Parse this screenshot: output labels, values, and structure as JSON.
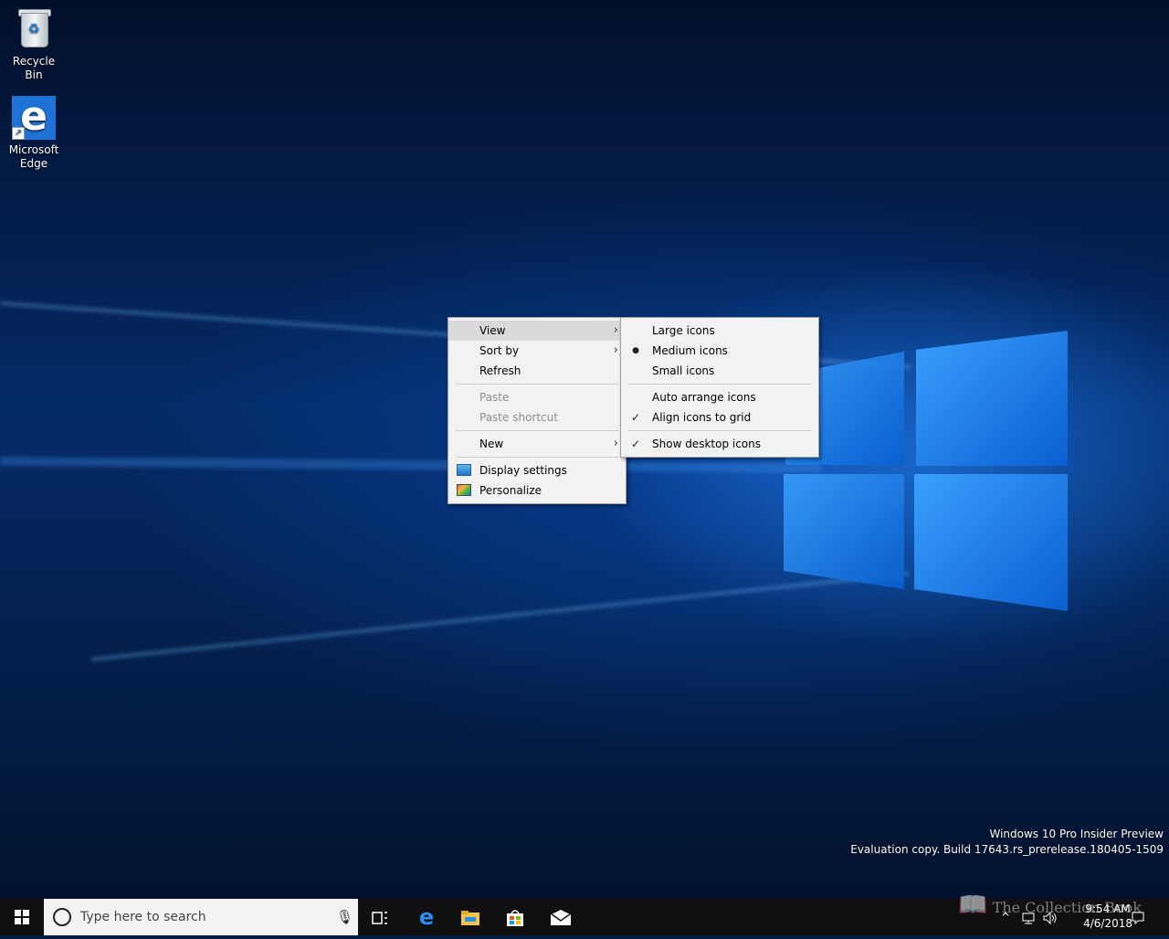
{
  "desktop": {
    "icons": [
      {
        "label": "Recycle Bin",
        "icon": "recycle-bin-icon"
      },
      {
        "label_line1": "Microsoft",
        "label_line2": "Edge",
        "icon": "edge-icon"
      }
    ]
  },
  "context_menu": {
    "items": {
      "view": "View",
      "sort_by": "Sort by",
      "refresh": "Refresh",
      "paste": "Paste",
      "paste_shortcut": "Paste shortcut",
      "new": "New",
      "display_settings": "Display settings",
      "personalize": "Personalize"
    },
    "submenu_arrow": "›"
  },
  "view_submenu": {
    "large_icons": "Large icons",
    "medium_icons": "Medium icons",
    "small_icons": "Small icons",
    "auto_arrange": "Auto arrange icons",
    "align_to_grid": "Align icons to grid",
    "show_desktop_icons": "Show desktop icons",
    "selected_size": "Medium icons",
    "checked": [
      "Align icons to grid",
      "Show desktop icons"
    ],
    "bullet": "●",
    "check": "✓"
  },
  "watermark": {
    "line1": "Windows 10 Pro Insider Preview",
    "line2": "Evaluation copy. Build 17643.rs_prerelease.180405-1509"
  },
  "taskbar": {
    "search_placeholder": "Type here to search",
    "pinned": [
      "task-view-icon",
      "edge-icon",
      "file-explorer-icon",
      "store-icon",
      "mail-icon"
    ],
    "clock_time": "9:54 AM",
    "clock_date": "4/6/2018",
    "overlay_text": "The Collection Book",
    "tray_chevron": "^"
  },
  "colors": {
    "taskbar": "#101010",
    "menu_bg": "#f2f2f2",
    "menu_highlight": "#dadada",
    "edge_blue": "#1f73d8"
  }
}
